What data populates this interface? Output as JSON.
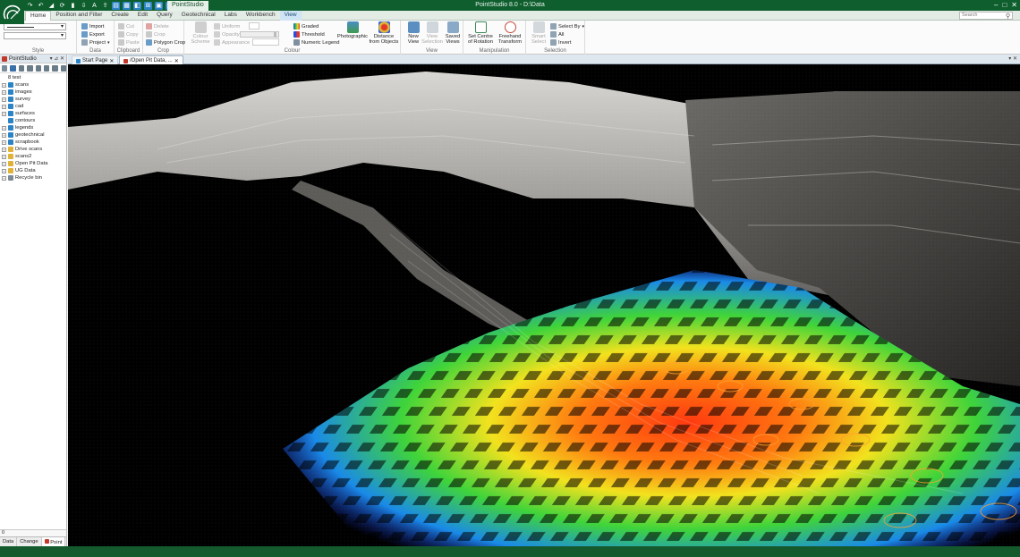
{
  "window": {
    "title": "PointStudio 8.0 - D:\\Data",
    "context_tab": "PointStudio",
    "controls": [
      "–",
      "□",
      "✕"
    ]
  },
  "colors": {
    "brand": "#0f5e2e",
    "accent_blue": "#2b84c6",
    "status_bar": "#145a2c"
  },
  "quick_access": [
    "redo-icon",
    "undo-icon",
    "run-icon",
    "save-icon",
    "import-icon",
    "tool-icons"
  ],
  "ribbon_tabs": [
    {
      "label": "Home",
      "active": true
    },
    {
      "label": "Position and Filter"
    },
    {
      "label": "Create"
    },
    {
      "label": "Edit"
    },
    {
      "label": "Query"
    },
    {
      "label": "Geotechnical"
    },
    {
      "label": "Labs"
    },
    {
      "label": "Workbench"
    },
    {
      "label": "View",
      "contextual": true
    }
  ],
  "search": {
    "placeholder": "Search"
  },
  "ribbon": {
    "style": {
      "label": "Style"
    },
    "data": {
      "label": "Data",
      "import": "Import",
      "export": "Export",
      "project": "Project"
    },
    "clipboard": {
      "label": "Clipboard",
      "cut": "Cut",
      "copy": "Copy",
      "paste": "Paste"
    },
    "crop": {
      "label": "Crop",
      "delete": "Delete",
      "crop": "Crop",
      "polygon_crop": "Polygon Crop"
    },
    "colour": {
      "label": "Colour",
      "colour_scheme": "Colour\nScheme",
      "uniform": "Uniform",
      "opacity": "Opacity",
      "appearance": "Appearance",
      "graded": "Graded",
      "threshold": "Threshold",
      "numeric_legend": "Numeric Legend",
      "photographic": "Photographic",
      "distance_from_objects": "Distance\nfrom Objects"
    },
    "view": {
      "label": "View",
      "new_view": "New\nView",
      "view_selection": "View\nSelection",
      "saved_views": "Saved\nViews"
    },
    "manipulation": {
      "label": "Manipulation",
      "set_centre": "Set Centre\nof Rotation",
      "freehand": "Freehand\nTransform"
    },
    "selection": {
      "label": "Selection",
      "smart_select": "Smart\nSelect",
      "select_by": "Select By",
      "all": "All",
      "invert": "Invert"
    }
  },
  "side_panel": {
    "title": "PointStudio",
    "tree": [
      {
        "label": "8 test",
        "root": true
      },
      {
        "label": "scans",
        "icon": "#2b84c6",
        "expander": true
      },
      {
        "label": "images",
        "icon": "#2b84c6",
        "expander": true
      },
      {
        "label": "survey",
        "icon": "#2b84c6",
        "expander": true
      },
      {
        "label": "cad",
        "icon": "#2b84c6",
        "expander": true
      },
      {
        "label": "surfaces",
        "icon": "#2b84c6",
        "expander": true
      },
      {
        "label": "contours",
        "icon": "#2b84c6",
        "expander": false
      },
      {
        "label": "legends",
        "icon": "#2b84c6",
        "expander": true
      },
      {
        "label": "geotechnical",
        "icon": "#2b84c6",
        "expander": true
      },
      {
        "label": "scrapbook",
        "icon": "#2b84c6",
        "expander": true
      },
      {
        "label": "Drive scans",
        "icon": "#e0b23a",
        "expander": true
      },
      {
        "label": "scans2",
        "icon": "#e0b23a",
        "expander": true
      },
      {
        "label": "Open Pit Data",
        "icon": "#e0b23a",
        "expander": true
      },
      {
        "label": "UG Data",
        "icon": "#e0b23a",
        "expander": true
      },
      {
        "label": "Recycle bin",
        "icon": "#7c8a95",
        "expander": true
      }
    ],
    "status_value": "0",
    "tabs": [
      {
        "label": "Data"
      },
      {
        "label": "Change"
      },
      {
        "label": "Point",
        "active": true
      }
    ]
  },
  "document_tabs": [
    {
      "label": "Start Page",
      "active": false
    },
    {
      "label": "/Open Pit Data, ...",
      "active": true
    }
  ]
}
